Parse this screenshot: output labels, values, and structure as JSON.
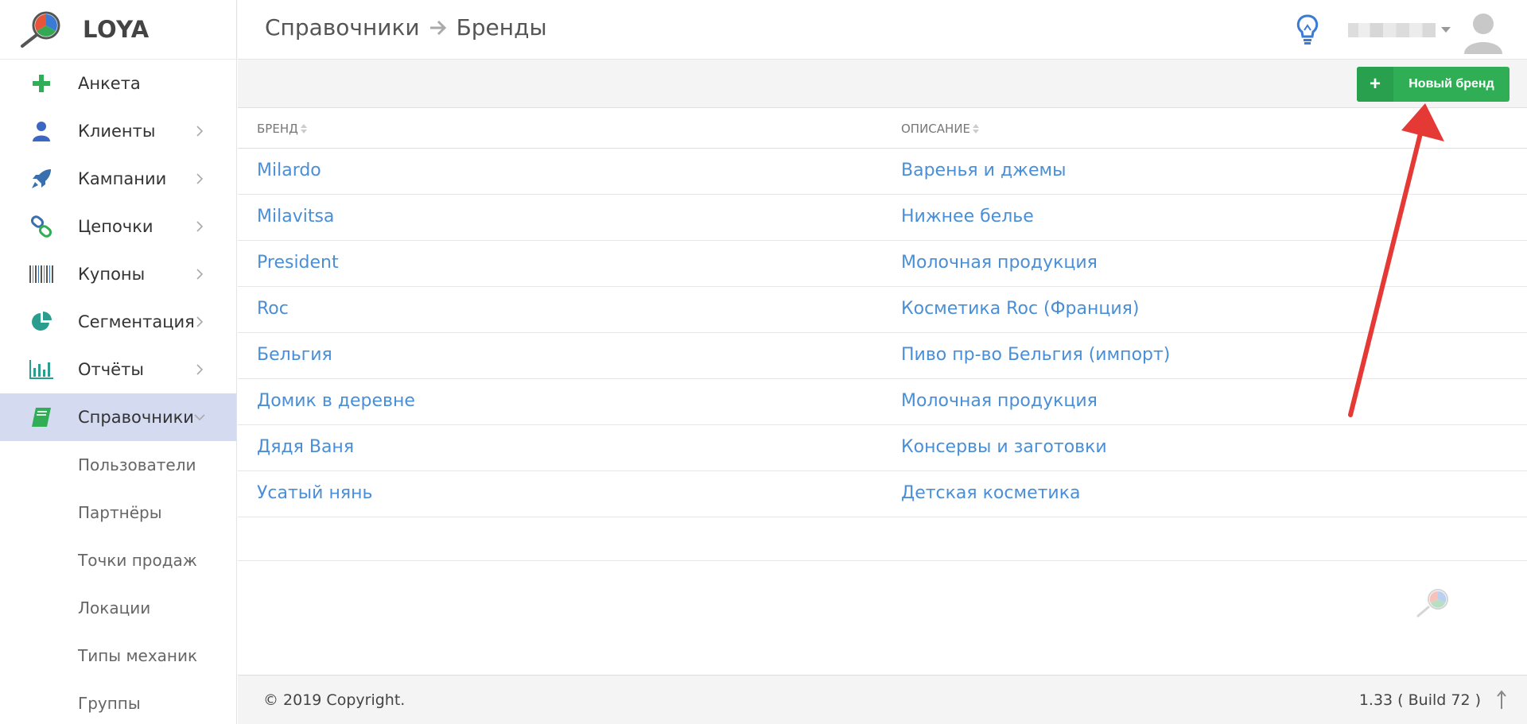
{
  "app": {
    "logo_text": "LOYA"
  },
  "breadcrumb": {
    "parent": "Справочники",
    "current": "Бренды"
  },
  "sidebar": {
    "items": [
      {
        "label": "Анкета",
        "icon": "plus-icon",
        "has_chevron": false
      },
      {
        "label": "Клиенты",
        "icon": "person-icon",
        "has_chevron": true
      },
      {
        "label": "Кампании",
        "icon": "rocket-icon",
        "has_chevron": true
      },
      {
        "label": "Цепочки",
        "icon": "link-icon",
        "has_chevron": true
      },
      {
        "label": "Купоны",
        "icon": "barcode-icon",
        "has_chevron": true
      },
      {
        "label": "Сегментация",
        "icon": "pie-chart-icon",
        "has_chevron": true
      },
      {
        "label": "Отчёты",
        "icon": "bar-chart-icon",
        "has_chevron": true
      },
      {
        "label": "Справочники",
        "icon": "book-icon",
        "has_chevron": true,
        "active": true
      }
    ],
    "sub_items": [
      "Пользователи",
      "Партнёры",
      "Точки продаж",
      "Локации",
      "Типы механик",
      "Группы"
    ]
  },
  "toolbar": {
    "new_label": "Новый бренд",
    "plus_glyph": "+"
  },
  "table": {
    "headers": {
      "brand": "БРЕНД",
      "description": "ОПИСАНИЕ"
    },
    "rows": [
      {
        "brand": "Milardo",
        "description": "Варенья и джемы"
      },
      {
        "brand": "Milavitsa",
        "description": "Нижнее белье"
      },
      {
        "brand": "President",
        "description": "Молочная продукция"
      },
      {
        "brand": "Roc",
        "description": "Косметика Roc (Франция)"
      },
      {
        "brand": "Бельгия",
        "description": "Пиво пр-во Бельгия (импорт)"
      },
      {
        "brand": "Домик в деревне",
        "description": "Молочная продукция"
      },
      {
        "brand": "Дядя Ваня",
        "description": "Консервы и заготовки"
      },
      {
        "brand": "Усатый нянь",
        "description": "Детская косметика"
      }
    ]
  },
  "footer": {
    "copyright": "© 2019 Copyright.",
    "version": "1.33 ( Build 72 )"
  },
  "colors": {
    "accent_green": "#2fae55",
    "link_blue": "#4a8fd6",
    "active_bg": "#d4dbf1",
    "annotation_red": "#e53935"
  }
}
